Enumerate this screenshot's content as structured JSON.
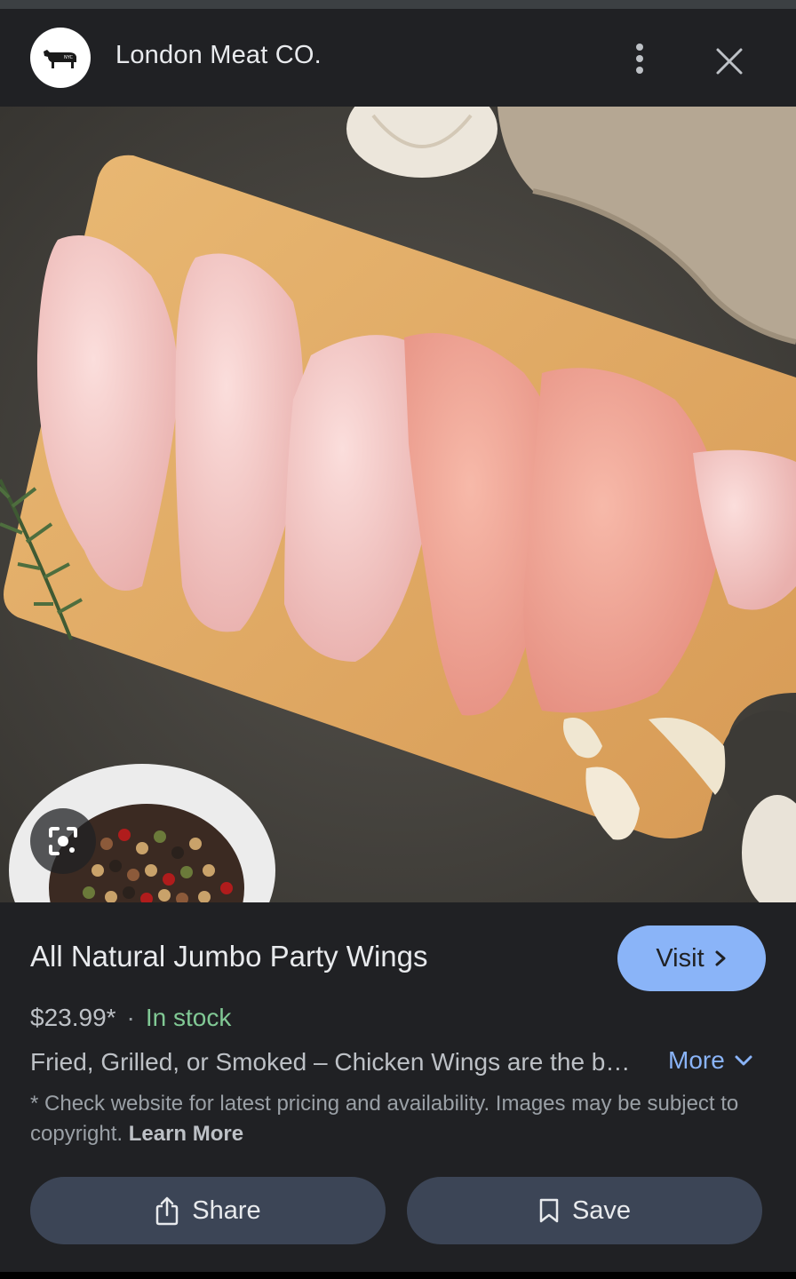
{
  "header": {
    "logo_text": "NYC",
    "site_name": "London Meat CO."
  },
  "image": {
    "description_icon": "camera-lens-icon"
  },
  "product": {
    "title": "All Natural Jumbo Party Wings",
    "visit_label": "Visit",
    "price": "$23.99*",
    "separator": "·",
    "stock": "In stock",
    "description": "Fried, Grilled, or Smoked – Chicken Wings are the best party food",
    "more_label": "More",
    "note_prefix": "* Check website for latest pricing and availability. Images may be subject to copyright.",
    "learn_more": "Learn More"
  },
  "actions": {
    "share_label": "Share",
    "save_label": "Save"
  },
  "colors": {
    "background": "#202124",
    "accent": "#8ab4f8",
    "in_stock": "#81c995",
    "button_bg": "#3c4556"
  }
}
